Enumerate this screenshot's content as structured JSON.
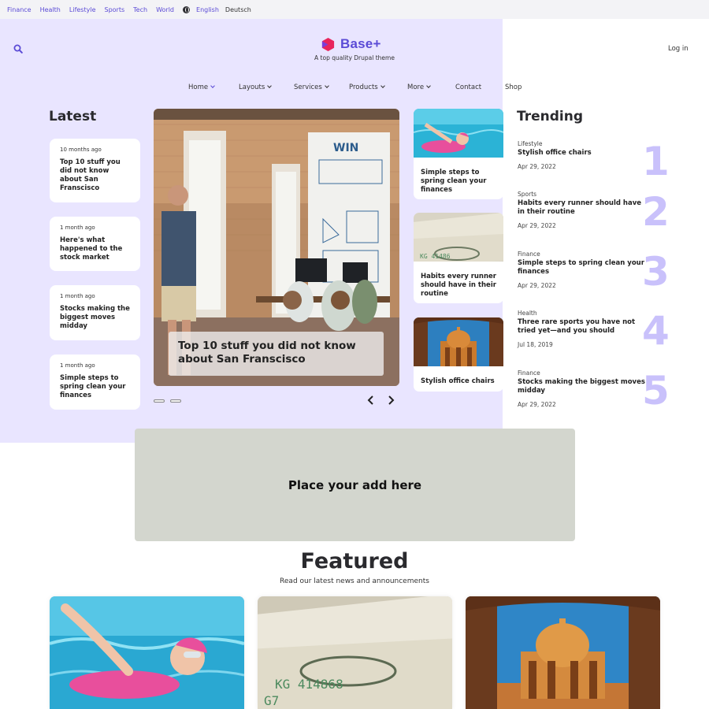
{
  "topbar": {
    "links": [
      "Finance",
      "Health",
      "Lifestyle",
      "Sports",
      "Tech",
      "World"
    ],
    "languages": [
      "English",
      "Deutsch"
    ],
    "active_language": "English"
  },
  "header": {
    "logo_text": "Base+",
    "tagline": "A top quality Drupal theme",
    "login_label": "Log in"
  },
  "nav": {
    "items": [
      {
        "label": "Home",
        "dropdown": true,
        "active": true
      },
      {
        "label": "Layouts",
        "dropdown": true
      },
      {
        "label": "Services",
        "dropdown": true
      },
      {
        "label": "Products",
        "dropdown": true
      },
      {
        "label": "More",
        "dropdown": true
      },
      {
        "label": "Contact",
        "dropdown": false
      },
      {
        "label": "Shop",
        "dropdown": false
      }
    ]
  },
  "latest": {
    "heading": "Latest",
    "items": [
      {
        "ago": "10 months ago",
        "title": "Top 10 stuff you did not know about San Franscisco"
      },
      {
        "ago": "1 month ago",
        "title": "Here's what happened to the stock market"
      },
      {
        "ago": "1 month ago",
        "title": "Stocks making the biggest moves midday"
      },
      {
        "ago": "1 month ago",
        "title": "Simple steps to spring clean your finances"
      }
    ]
  },
  "hero": {
    "caption": "Top 10 stuff you did not know about San Franscisco",
    "slide_count": 2
  },
  "mini_cards": [
    {
      "title": "Simple steps to spring clean your finances",
      "image": "swimmer"
    },
    {
      "title": "Habits every runner should have in their routine",
      "image": "dollar-bills"
    },
    {
      "title": "Stylish office chairs",
      "image": "indian-architecture"
    }
  ],
  "trending": {
    "heading": "Trending",
    "items": [
      {
        "rank": "1",
        "category": "Lifestyle",
        "title": "Stylish office chairs",
        "date": "Apr 29, 2022"
      },
      {
        "rank": "2",
        "category": "Sports",
        "title": "Habits every runner should have in their routine",
        "date": "Apr 29, 2022"
      },
      {
        "rank": "3",
        "category": "Finance",
        "title": "Simple steps to spring clean your finances",
        "date": "Apr 29, 2022"
      },
      {
        "rank": "4",
        "category": "Health",
        "title": "Three rare sports you have not tried yet—and you should",
        "date": "Jul 18, 2019"
      },
      {
        "rank": "5",
        "category": "Finance",
        "title": "Stocks making the biggest moves midday",
        "date": "Apr 29, 2022"
      }
    ]
  },
  "ad": {
    "text": "Place your add here"
  },
  "featured": {
    "heading": "Featured",
    "subheading": "Read our latest news and announcements",
    "cards": [
      {
        "image": "swimmer"
      },
      {
        "image": "dollar-bills"
      },
      {
        "image": "indian-architecture"
      }
    ]
  },
  "colors": {
    "accent": "#5b4bd6",
    "lavender_bg": "#e9e5ff",
    "trending_number": "#c9c1fb",
    "logo_pink": "#e8245c",
    "ad_bg": "#d3d6ce"
  },
  "icons": {
    "search": "search-icon",
    "language": "globe-icon",
    "prev": "chevron-left-icon",
    "next": "chevron-right-icon",
    "logo": "hexagon-logo-icon"
  }
}
